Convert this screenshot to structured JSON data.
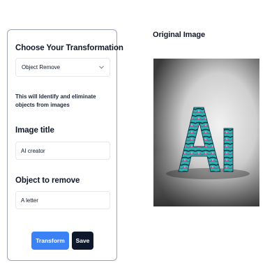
{
  "form": {
    "transformation_heading": "Choose Your Transformation",
    "transformation_selected": "Object Remove",
    "description": "This will Identify and eliminate objects from images",
    "image_title_label": "Image title",
    "image_title_value": "AI creator",
    "object_label": "Object to remove",
    "object_value": "A letter",
    "transform_label": "Transform",
    "save_label": "Save"
  },
  "preview": {
    "title": "Original Image"
  },
  "colors": {
    "primary": "#3b82f6",
    "dark": "#0f172a",
    "panel_border": "#9aa5b6"
  }
}
